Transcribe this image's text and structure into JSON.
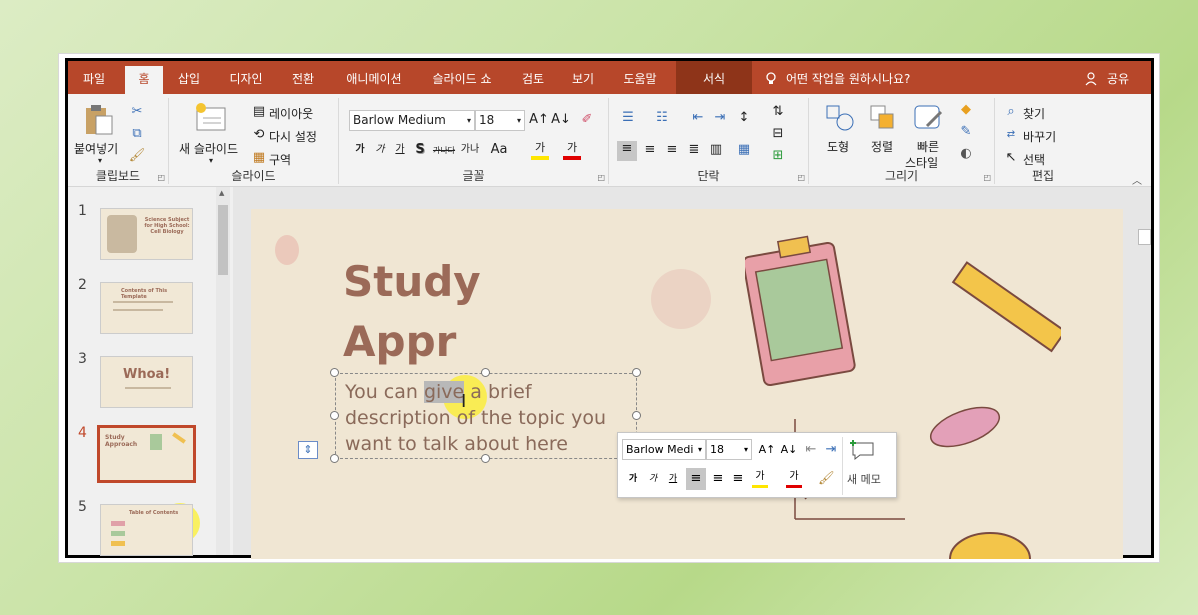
{
  "tabs": [
    "파일",
    "홈",
    "삽입",
    "디자인",
    "전환",
    "애니메이션",
    "슬라이드 쇼",
    "검토",
    "보기",
    "도움말",
    "서식"
  ],
  "tell_me": "어떤 작업을 원하시나요?",
  "share": "공유",
  "clipboard": {
    "paste": "붙여넣기",
    "label": "클립보드"
  },
  "slides_group": {
    "new_slide": "새 슬라이드",
    "layout": "레이아웃",
    "reset": "다시 설정",
    "section": "구역",
    "label": "슬라이드"
  },
  "font_group": {
    "font": "Barlow Medium",
    "size": "18",
    "label": "글꼴",
    "bold": "가",
    "italic": "가",
    "underline": "가",
    "shadow": "S",
    "strike": "가나다",
    "spacing": "가나",
    "case": "Aa",
    "highlight": "가",
    "color": "가"
  },
  "paragraph_group": {
    "label": "단락"
  },
  "drawing_group": {
    "shapes": "도형",
    "arrange": "정렬",
    "quick_styles_1": "빠른",
    "quick_styles_2": "스타일",
    "label": "그리기"
  },
  "editing_group": {
    "find": "찾기",
    "replace": "바꾸기",
    "select": "선택",
    "label": "편집"
  },
  "thumbnails": [
    "1",
    "2",
    "3",
    "4",
    "5"
  ],
  "thumb_text": {
    "t1": "Science Subject for High School: Cell Biology",
    "t2": "Contents of This Template",
    "t3": "Whoa!",
    "t4": "Study Approach",
    "t5": "Table of Contents"
  },
  "slide": {
    "title_1": "Study",
    "title_2": "Appr",
    "body_before": "You can ",
    "body_selected": "give",
    "body_after": " a brief",
    "body_line2": "description of the topic you",
    "body_line3": "want to talk about here"
  },
  "mini_toolbar": {
    "font": "Barlow Medi",
    "size": "18",
    "memo": "새 메모"
  },
  "colors": {
    "accent": "#b7472a",
    "title": "#9b6a58",
    "slide_bg": "#f0e6d3"
  }
}
